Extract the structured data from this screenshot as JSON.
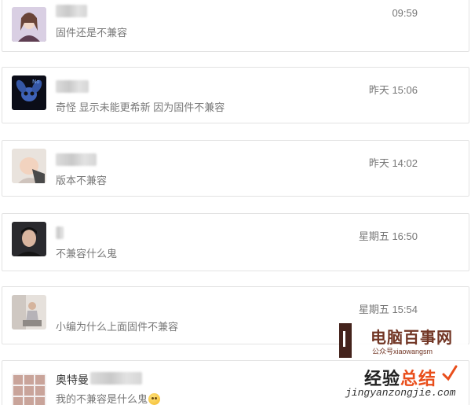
{
  "conversations": [
    {
      "name": "",
      "message": "固件还是不兼容",
      "time": "09:59",
      "avatar": "woman-portrait"
    },
    {
      "name": "",
      "message": "奇怪 显示未能更希新 因为固件不兼容",
      "time": "昨天 15:06",
      "avatar": "cartoon-character"
    },
    {
      "name": "",
      "message": "版本不兼容",
      "time": "昨天 14:02",
      "avatar": "baby-photo"
    },
    {
      "name": "",
      "message": "不兼容什么鬼",
      "time": "星期五 16:50",
      "avatar": "young-man-portrait"
    },
    {
      "name": "",
      "message": "小编为什么上面固件不兼容",
      "time": "星期五 15:54",
      "avatar": "person-sitting"
    },
    {
      "name": "奥特曼",
      "message": "我的不兼容是什么鬼",
      "time": "",
      "avatar": "photo-grid"
    }
  ],
  "watermarks": {
    "wm1_title": "电脑百事网",
    "wm1_sub": "公众号xiaowangsm",
    "wm2_title_a": "经验",
    "wm2_title_b": "总结",
    "wm2_sub": "jingyanzongjie.com"
  },
  "colors": {
    "border": "#e3e3e3",
    "wm1": "#6b2c1a",
    "wm2_accent": "#e94e1b"
  }
}
